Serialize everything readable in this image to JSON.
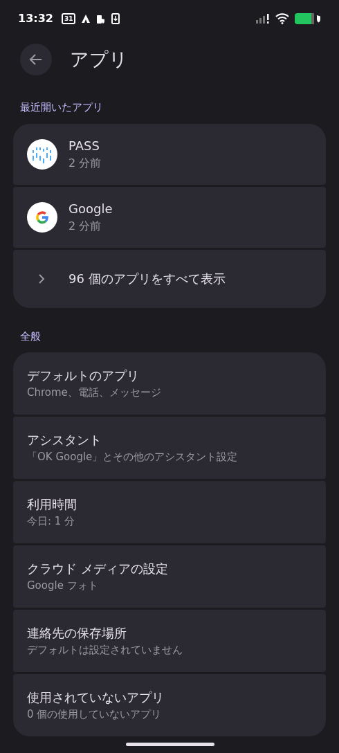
{
  "status_bar": {
    "time": "13:32",
    "calendar_day": "31"
  },
  "header": {
    "title": "アプリ"
  },
  "sections": [
    {
      "title": "最近開いたアプリ",
      "items": [
        {
          "kind": "app",
          "title": "PASS",
          "subtitle": "2 分前"
        },
        {
          "kind": "app",
          "title": "Google",
          "subtitle": "2 分前"
        },
        {
          "kind": "link",
          "title": "96 個のアプリをすべて表示"
        }
      ]
    },
    {
      "title": "全般",
      "items": [
        {
          "kind": "setting",
          "title": "デフォルトのアプリ",
          "subtitle": "Chrome、電話、メッセージ"
        },
        {
          "kind": "setting",
          "title": "アシスタント",
          "subtitle": "「OK Google」とその他のアシスタント設定"
        },
        {
          "kind": "setting",
          "title": "利用時間",
          "subtitle": "今日: 1 分"
        },
        {
          "kind": "setting",
          "title": "クラウド メディアの設定",
          "subtitle": "Google フォト"
        },
        {
          "kind": "setting",
          "title": "連絡先の保存場所",
          "subtitle": "デフォルトは設定されていません"
        },
        {
          "kind": "setting",
          "title": "使用されていないアプリ",
          "subtitle": "0 個の使用していないアプリ"
        }
      ]
    }
  ]
}
